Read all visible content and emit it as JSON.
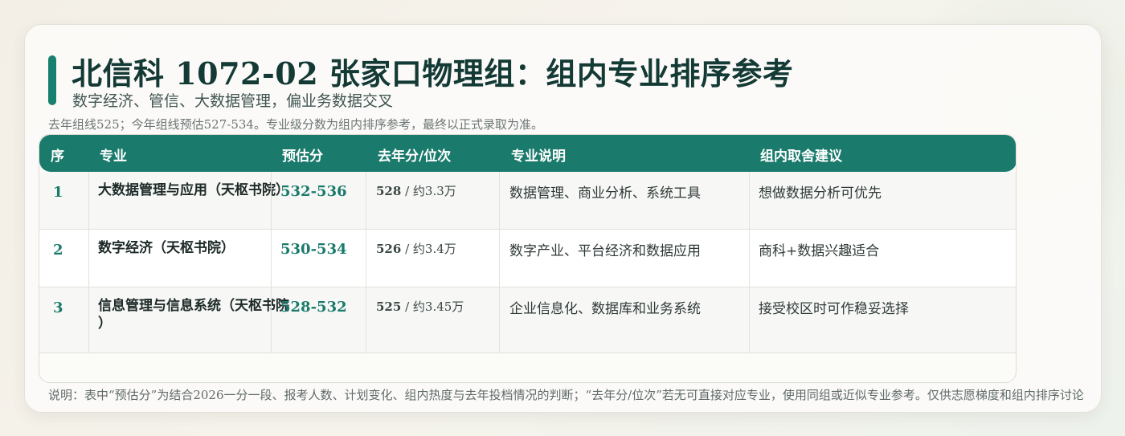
{
  "header": {
    "title": "北信科 1072-02 张家口物理组：组内专业排序参考",
    "subtitle": "数字经济、管信、大数据管理，偏业务数据交叉",
    "note": "去年组线525；今年组线预估527-534。专业级分数为组内排序参考，最终以正式录取为准。"
  },
  "table": {
    "columns": [
      "序",
      "专业",
      "预估分",
      "去年分/位次",
      "专业说明",
      "组内取舍建议"
    ],
    "rows": [
      {
        "idx": "1",
        "major_line1": "大数据管理与应用（天枢书院）",
        "major_line2": "",
        "estimate": "532-536",
        "last_score": "528",
        "last_sep": " / ",
        "last_rank": "约3.3万",
        "desc": "数据管理、商业分析、系统工具",
        "advice": "想做数据分析可优先"
      },
      {
        "idx": "2",
        "major_line1": "数字经济（天枢书院）",
        "major_line2": "",
        "estimate": "530-534",
        "last_score": "526",
        "last_sep": " / ",
        "last_rank": "约3.4万",
        "desc": "数字产业、平台经济和数据应用",
        "advice": "商科+数据兴趣适合"
      },
      {
        "idx": "3",
        "major_line1": "信息管理与信息系统（天枢书院",
        "major_line2": "）",
        "estimate": "528-532",
        "last_score": "525",
        "last_sep": " / ",
        "last_rank": "约3.45万",
        "desc": "企业信息化、数据库和业务系统",
        "advice": "接受校区时可作稳妥选择"
      }
    ]
  },
  "footer": {
    "note": "说明：表中“预估分”为结合2026一分一段、报考人数、计划变化、组内热度与去年投档情况的判断；“去年分/位次”若无可直接对应专业，使用同组或近似专业参考。仅供志愿梯度和组内排序讨论"
  },
  "colors": {
    "accent": "#1a7a6c",
    "title": "#133a35"
  }
}
